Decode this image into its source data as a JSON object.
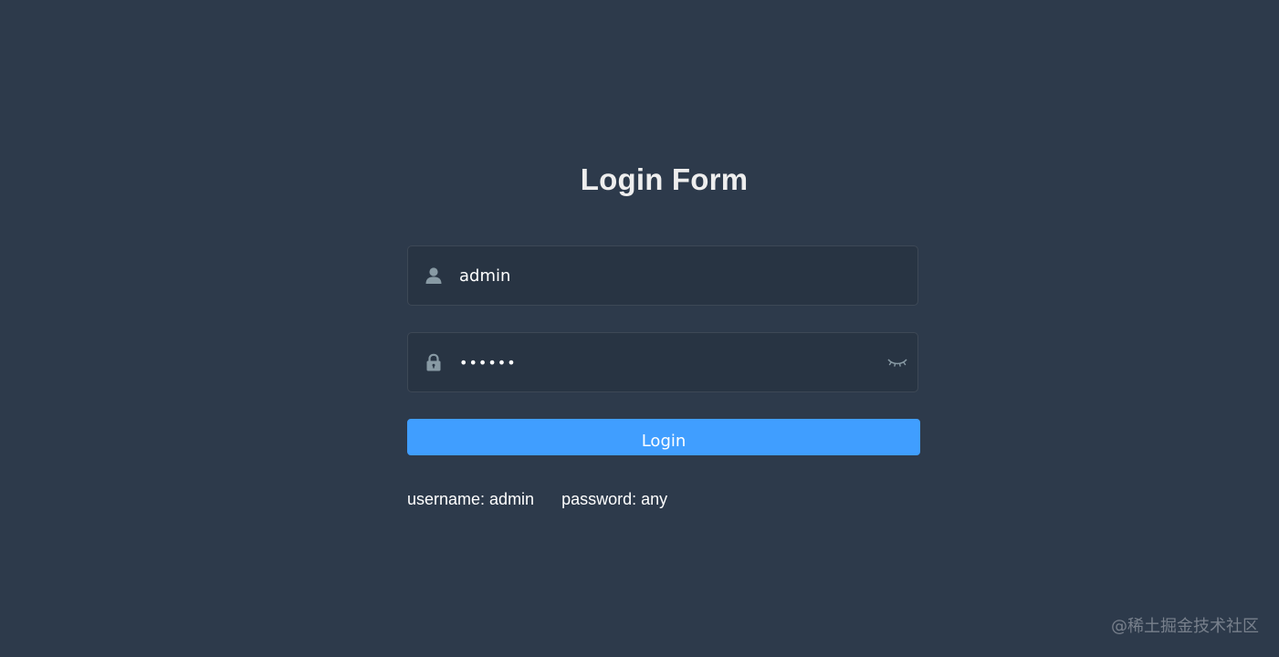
{
  "form": {
    "title": "Login Form",
    "username": {
      "value": "admin",
      "icon": "user-icon"
    },
    "password": {
      "value": "••••••",
      "icon": "lock-icon",
      "toggle_icon": "eye-closed-icon"
    },
    "login_label": "Login"
  },
  "tips": {
    "username": "username: admin",
    "password": "password: any"
  },
  "watermark": "@稀土掘金技术社区",
  "colors": {
    "background": "#2d3a4b",
    "input_background": "#283443",
    "primary": "#409eff",
    "icon": "#889aa4"
  }
}
